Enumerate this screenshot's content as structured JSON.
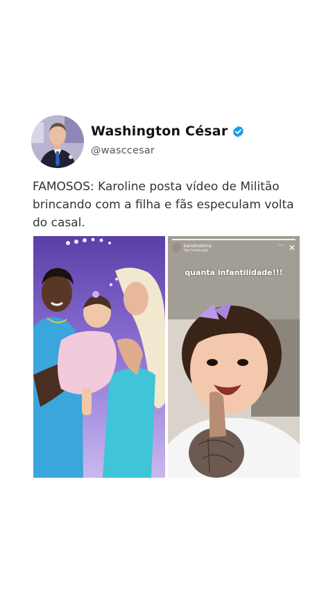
{
  "author": {
    "name": "Washington César",
    "handle": "@wasccesar",
    "verified": true,
    "verified_color": "#1d9bf0",
    "avatar_icon": "profile-photo"
  },
  "post": {
    "text": "FAMOSOS: Karoline posta vídeo de Militão brincando com a filha e fãs especulam volta do casal."
  },
  "media": {
    "left": {
      "description_icon": "family-party-photo"
    },
    "right": {
      "story_user": "karolinelima",
      "story_sub": "Ver tradução",
      "caption": "quanta infantilidade!!!",
      "close_glyph": "✕",
      "more_glyph": "···"
    }
  },
  "colors": {
    "text_primary": "#111111",
    "text_secondary": "#555555",
    "background": "#ffffff"
  }
}
